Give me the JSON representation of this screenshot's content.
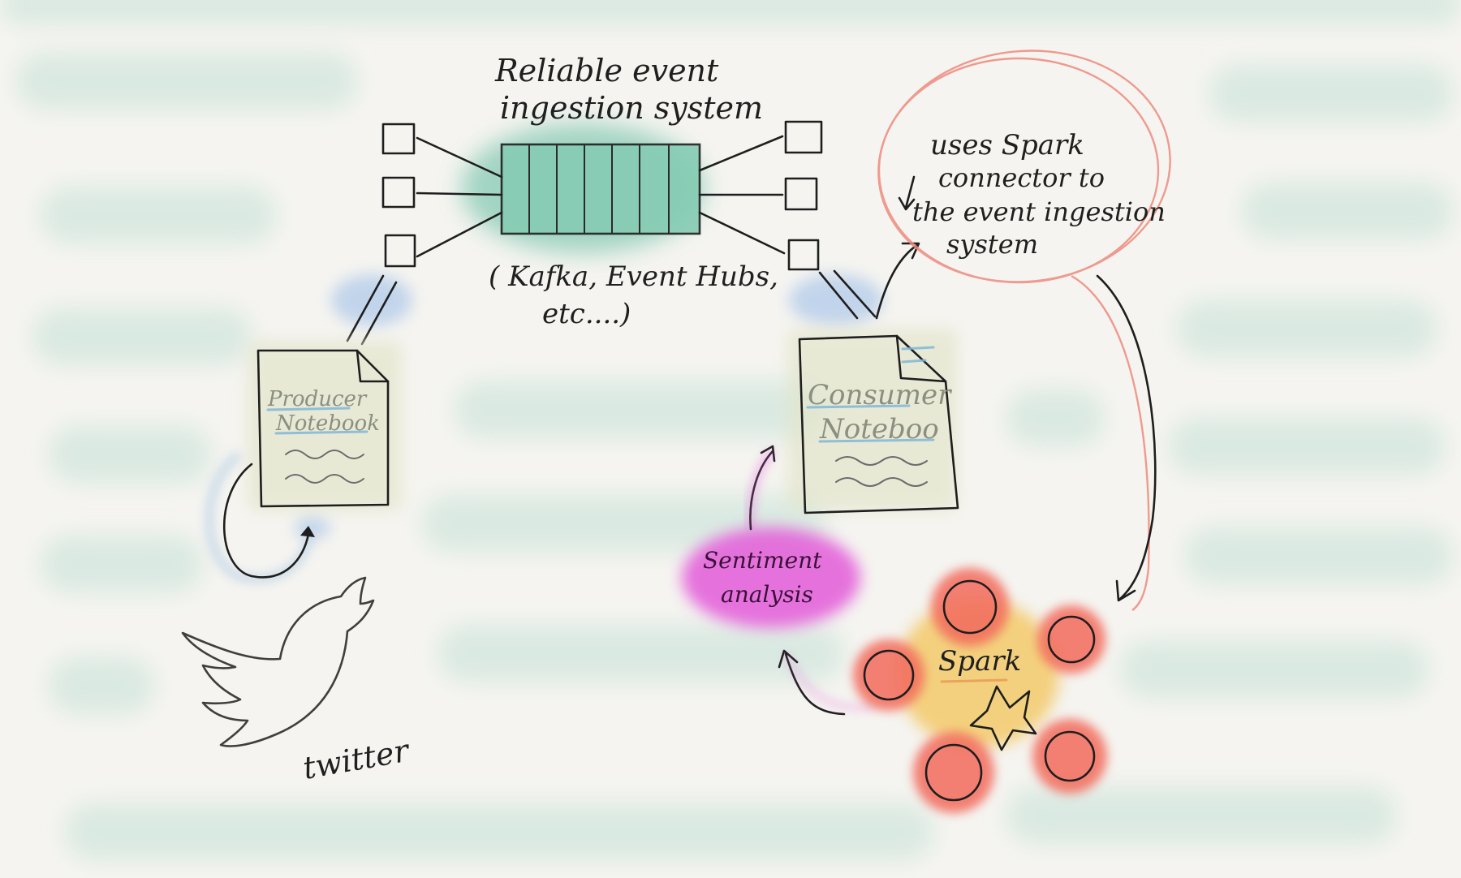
{
  "labels": {
    "ingestion_title_line1": "Reliable event",
    "ingestion_title_line2": "ingestion system",
    "ingestion_examples_line1": "( Kafka, Event Hubs,",
    "ingestion_examples_line2": "etc....)",
    "producer_line1": "Producer",
    "producer_line2": "Notebook",
    "consumer_line1": "Consumer",
    "consumer_line2": "Noteboo",
    "connector_line1": "uses Spark",
    "connector_line2": "connector to",
    "connector_line3": "the event ingestion",
    "connector_line4": "system",
    "sentiment_line1": "Sentiment",
    "sentiment_line2": "analysis",
    "spark": "Spark",
    "twitter": "twitter"
  },
  "colors": {
    "background": "#f5f4f0",
    "background_blur": "#cfe5dc",
    "queue": "#7fc7b0",
    "notebook_fill": "#dfe0c6",
    "blue_glow": "#b6cdea",
    "twitter_bird": "#7fb1cf",
    "sentiment_blob": "#e35bd9",
    "spark_node": "#f26a5c",
    "spark_center": "#f3c969",
    "spark_star": "#e8c35a",
    "callout_circle": "#ee8a7c"
  },
  "icons": {
    "bird": "twitter-bird-icon",
    "star": "spark-star-icon",
    "document": "notebook-document-icon"
  }
}
